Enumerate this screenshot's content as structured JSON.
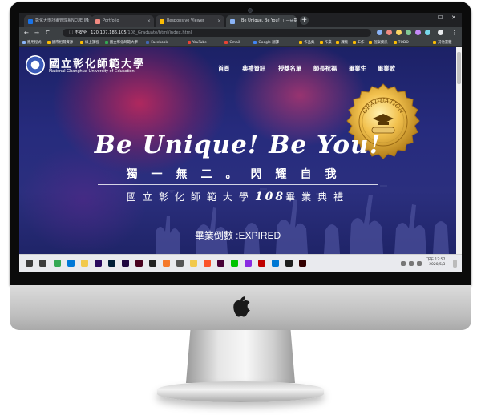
{
  "browser": {
    "tabs": [
      {
        "label": "彰化大學計畫管理系NCUE IM",
        "favicon_color": "#1a73e8",
        "active": false
      },
      {
        "label": "Portfolio",
        "favicon_color": "#f28b82",
        "active": false
      },
      {
        "label": "Responsive Viewer",
        "favicon_color": "#fbbc04",
        "active": false
      },
      {
        "label": "「Be Unique, Be You！」——彰",
        "favicon_color": "#8ab4f8",
        "active": true
      }
    ],
    "new_tab_glyph": "+",
    "window_controls": {
      "minimize": "—",
      "maximize": "☐",
      "close": "✕"
    },
    "nav": {
      "back": "←",
      "forward": "→",
      "reload": "C"
    },
    "address": {
      "security": "ⓘ 不安全",
      "host": "120.107.186.105",
      "path": "/108_Graduate/html/index.html"
    },
    "bookmarks": [
      {
        "label": "應用程式",
        "color": "#8ab4f8"
      },
      {
        "label": "國際相關資源",
        "color": "#fbbc04"
      },
      {
        "label": "線上課程",
        "color": "#fbbc04"
      },
      {
        "label": "國立彰化師範大學",
        "color": "#34a853"
      },
      {
        "label": "Facebook",
        "color": "#4267b2"
      },
      {
        "label": "YouTube",
        "color": "#ea4335"
      },
      {
        "label": "Gmail",
        "color": "#ea4335"
      },
      {
        "label": "Google 翻譯",
        "color": "#4285f4"
      },
      {
        "label": "作品集",
        "color": "#fbbc04"
      },
      {
        "label": "作業",
        "color": "#fbbc04"
      },
      {
        "label": "課級",
        "color": "#fbbc04"
      },
      {
        "label": "工作",
        "color": "#fbbc04"
      },
      {
        "label": "個案資訊",
        "color": "#fbbc04"
      },
      {
        "label": "TODO",
        "color": "#fbbc04"
      },
      {
        "label": "其他書籤",
        "color": "#fbbc04"
      }
    ]
  },
  "site": {
    "logo_cn": "國立彰化師範大學",
    "logo_en": "National Changhua University of Education",
    "nav": [
      "首頁",
      "典禮資訊",
      "授獎名單",
      "師長祝福",
      "畢業生",
      "畢業歌"
    ],
    "headline": "Be Unique! Be You!",
    "motto": "獨一無二。閃耀自我",
    "ceremony_prefix": "國立彰化師範大學",
    "ceremony_number": "108",
    "ceremony_suffix": "畢業典禮",
    "countdown": "畢業倒數 :EXPIRED",
    "medal_text": "GRADUATION"
  },
  "taskbar": {
    "time": "下午 12:57",
    "date": "2020/5/3",
    "icons": [
      {
        "name": "start-icon",
        "color": "#3c3c3c"
      },
      {
        "name": "search-icon",
        "color": "#3c3c3c"
      },
      {
        "name": "chrome-icon",
        "color": "#34a853"
      },
      {
        "name": "edge-icon",
        "color": "#0078d7"
      },
      {
        "name": "explorer-icon",
        "color": "#f2c94c"
      },
      {
        "name": "premiere-icon",
        "color": "#2a0a5e"
      },
      {
        "name": "photoshop-icon",
        "color": "#001e36"
      },
      {
        "name": "aftereffects-icon",
        "color": "#1f0740"
      },
      {
        "name": "indesign-icon",
        "color": "#49021f"
      },
      {
        "name": "unity-icon",
        "color": "#222222"
      },
      {
        "name": "blender-icon",
        "color": "#f5792a"
      },
      {
        "name": "store-icon",
        "color": "#555555"
      },
      {
        "name": "folder-icon",
        "color": "#f2c94c"
      },
      {
        "name": "brave-icon",
        "color": "#fb542b"
      },
      {
        "name": "xd-icon",
        "color": "#470137"
      },
      {
        "name": "line-icon",
        "color": "#00c300"
      },
      {
        "name": "app-icon",
        "color": "#8a2be2"
      },
      {
        "name": "filezilla-icon",
        "color": "#bf0000"
      },
      {
        "name": "vscode-icon",
        "color": "#0078d4"
      },
      {
        "name": "terminal-icon",
        "color": "#1e1e1e"
      },
      {
        "name": "illustrator-icon",
        "color": "#330000"
      }
    ]
  }
}
